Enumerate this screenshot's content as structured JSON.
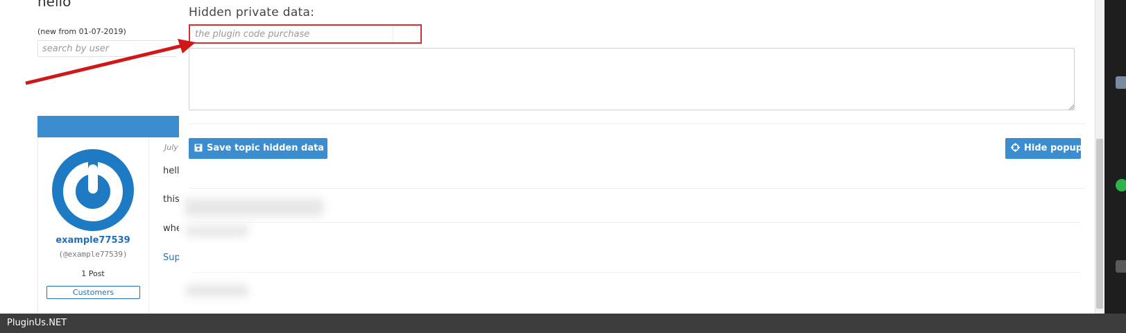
{
  "forum": {
    "heading": "hello",
    "new_from": "(new from 01-07-2019)",
    "search_placeholder": "search by user",
    "author": {
      "name": "example77539",
      "handle": "(@example77539)",
      "post_count": "1 Post",
      "role": "Customers"
    },
    "post": {
      "date": "July",
      "line1": "hell",
      "line2": "this",
      "line3": "whe",
      "link": "Sup"
    }
  },
  "popup": {
    "title": "Hidden private data:",
    "code_placeholder": "the plugin code purchase",
    "save_label": "Save topic hidden data",
    "hide_label": "Hide popup"
  },
  "taskbar": {
    "label": "PluginUs.NET"
  },
  "colors": {
    "accent": "#3b8dd0",
    "highlight_border": "#d32f2f",
    "arrow": "#d01818",
    "taskbar": "#3c3c3c"
  },
  "icons": {
    "save": "floppy-disk-icon",
    "hide": "crosshair-icon",
    "avatar": "power-logo"
  }
}
